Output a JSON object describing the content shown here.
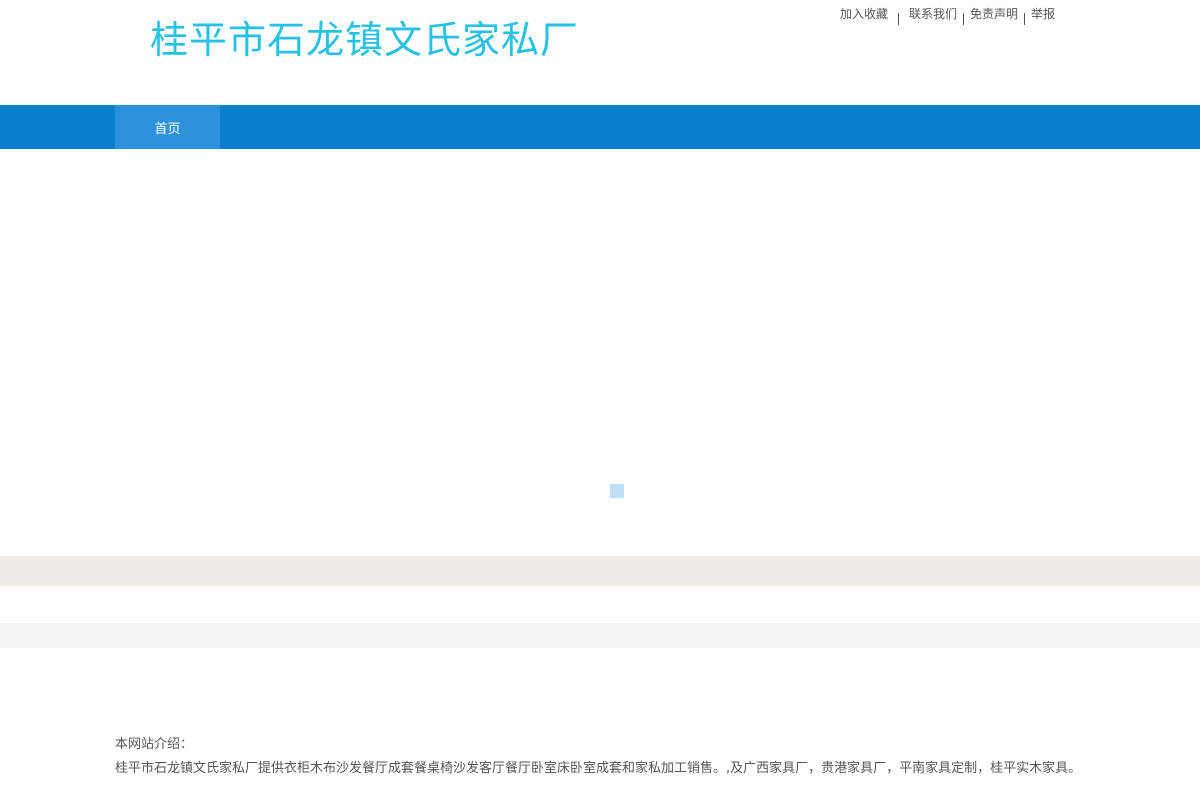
{
  "header": {
    "site_title": "桂平市石龙镇文氏家私厂",
    "links": [
      "加入收藏",
      "联系我们",
      "免责声明",
      "举报"
    ]
  },
  "nav": {
    "items": [
      "首页"
    ]
  },
  "intro": {
    "title": "本网站介绍：",
    "text": "桂平市石龙镇文氏家私厂提供衣柜木布沙发餐厅成套餐桌椅沙发客厅餐厅卧室床卧室成套和家私加工销售。,及广西家具厂，贵港家具厂，平南家具定制，桂平实木家具。"
  },
  "colors": {
    "title": "#27c1e4",
    "nav_bar": "#0a7fce",
    "nav_active": "#2d92dd",
    "band_beige": "#f0ebe6",
    "band_gray": "#f4f4f4"
  }
}
